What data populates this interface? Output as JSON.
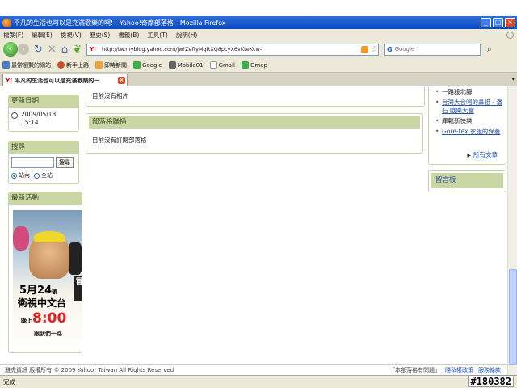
{
  "window": {
    "title": "平凡的生活也可以是充滿歡樂的啊! - Yahoo!奇摩部落格 - Mozilla Firefox",
    "buttons": {
      "minimize": "_",
      "maximize": "□",
      "close": "×"
    }
  },
  "menu": [
    "檔案(F)",
    "編輯(E)",
    "檢視(V)",
    "歷史(S)",
    "書籤(B)",
    "工具(T)",
    "說明(H)"
  ],
  "nav": {
    "url": "http://tw.myblog.yahoo.com/jw!ZeffyMqRXQ8pcyX6vKteKcw-",
    "search_placeholder": "Google",
    "search_engine": "G"
  },
  "bookmarks": [
    {
      "label": "最常瀏覽的網站",
      "color": "#4a7bc8"
    },
    {
      "label": "新手上路",
      "color": "#c8502a"
    },
    {
      "label": "即時新聞",
      "color": "#f2a33a"
    },
    {
      "label": "Google",
      "color": "#3cae4a"
    },
    {
      "label": "Mobile01",
      "color": "#666666"
    },
    {
      "label": "Gmail",
      "color": "#cccccc"
    },
    {
      "label": "Gmap",
      "color": "#3cae4a"
    }
  ],
  "tab": {
    "label": "平凡的生活也可以是充滿歡樂的一"
  },
  "sidebar": {
    "update_title": "更新日期",
    "update_date": "2009/05/13",
    "update_time": "15:14",
    "search_title": "搜尋",
    "search_button": "搜尋",
    "radio_site": "站內",
    "radio_all": "全站",
    "events_title": "最新活動"
  },
  "banner": {
    "date_num": "5月24",
    "date_suffix": "號",
    "channel": "衛視中文台",
    "time_prefix": "晚上",
    "time": "8:00",
    "follow": "跟我們一路",
    "side_tag": "冒"
  },
  "main": {
    "photos_text": "目前沒有相片",
    "subscribe_title": "部落格聯播",
    "subscribe_text": "目前沒有訂閱部落格"
  },
  "articles": {
    "items": [
      {
        "label": "一路殺北縣",
        "link": false
      },
      {
        "label": "台灣大合唱的鼻祖 - 潘石 戲樂天堂",
        "link": true
      },
      {
        "label": "庫載新快樂",
        "link": false
      },
      {
        "label": "Gore-tex 衣服的保養",
        "link": true
      }
    ],
    "all_label": "所有文章"
  },
  "guestbook": {
    "title": "留言板"
  },
  "footer": {
    "copyright": "雅虎資訊  版權所有 © 2009 Yahoo! Taiwan All Rights Reserved",
    "report": "「本部落格有問題」",
    "privacy": "隱私權政策",
    "terms": "服務條款"
  },
  "status": {
    "text": "完成",
    "watermark": "#180382"
  }
}
